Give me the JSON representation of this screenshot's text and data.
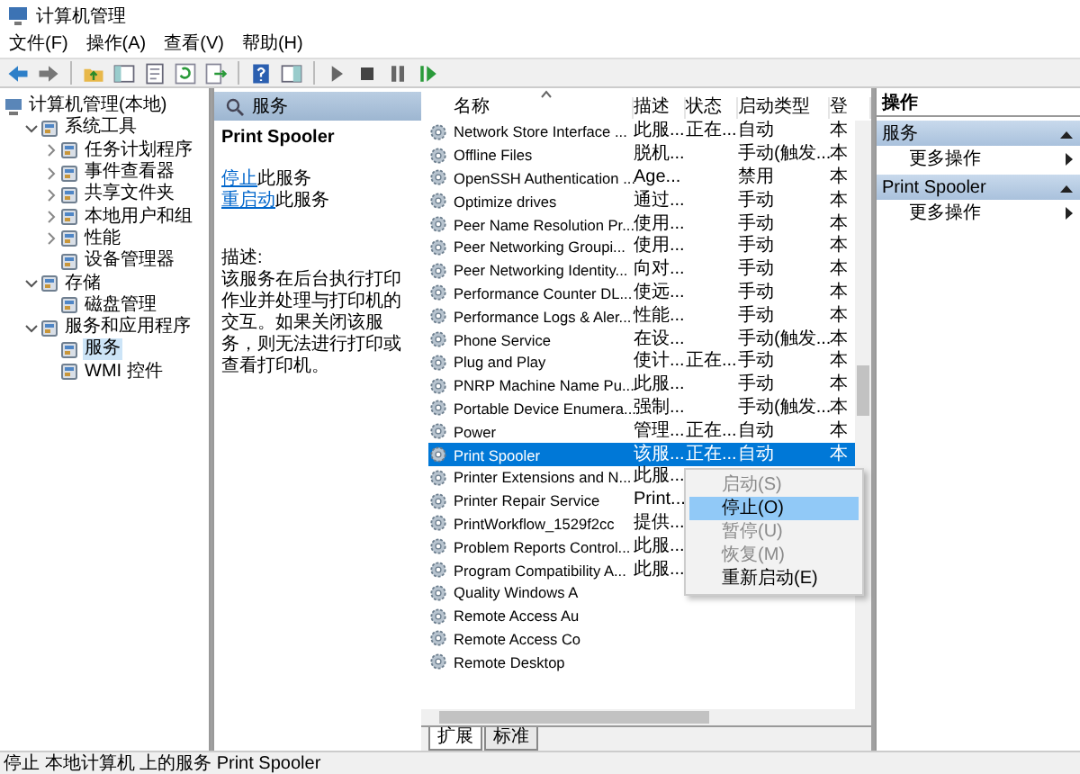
{
  "window": {
    "title": "计算机管理"
  },
  "menu": [
    "文件(F)",
    "操作(A)",
    "查看(V)",
    "帮助(H)"
  ],
  "tree": [
    {
      "label": "计算机管理(本地)",
      "selected": false,
      "children": [
        {
          "label": "系统工具",
          "expanded": true,
          "selected": false,
          "children": [
            {
              "label": "任务计划程序",
              "expanded": false,
              "selected": false
            },
            {
              "label": "事件查看器",
              "expanded": false,
              "selected": false
            },
            {
              "label": "共享文件夹",
              "expanded": false,
              "selected": false
            },
            {
              "label": "本地用户和组",
              "expanded": false,
              "selected": false
            },
            {
              "label": "性能",
              "expanded": false,
              "selected": false
            },
            {
              "label": "设备管理器",
              "selected": false
            }
          ]
        },
        {
          "label": "存储",
          "expanded": true,
          "selected": false,
          "children": [
            {
              "label": "磁盘管理",
              "selected": false
            }
          ]
        },
        {
          "label": "服务和应用程序",
          "expanded": true,
          "selected": false,
          "children": [
            {
              "label": "服务",
              "selected": true
            },
            {
              "label": "WMI 控件",
              "selected": false
            }
          ]
        }
      ]
    }
  ],
  "detail": {
    "header": "服务",
    "service_name": "Print Spooler",
    "links": [
      {
        "link": "停止",
        "text": "此服务"
      },
      {
        "link": "重启动",
        "text": "此服务"
      }
    ],
    "description_label": "描述:",
    "description": "该服务在后台执行打印作业并处理与打印机的交互。如果关闭该服务，则无法进行打印或查看打印机。"
  },
  "table": {
    "columns": [
      "名称",
      "描述",
      "状态",
      "启动类型",
      "登"
    ],
    "rows": [
      {
        "cells": [
          "Network Store Interface ...",
          "此服...",
          "正在...",
          "自动",
          "本"
        ],
        "selected": false
      },
      {
        "cells": [
          "Offline Files",
          "脱机...",
          "",
          "手动(触发...",
          "本"
        ],
        "selected": false
      },
      {
        "cells": [
          "OpenSSH Authentication ...",
          "Age...",
          "",
          "禁用",
          "本"
        ],
        "selected": false
      },
      {
        "cells": [
          "Optimize drives",
          "通过...",
          "",
          "手动",
          "本"
        ],
        "selected": false
      },
      {
        "cells": [
          "Peer Name Resolution Pr...",
          "使用...",
          "",
          "手动",
          "本"
        ],
        "selected": false
      },
      {
        "cells": [
          "Peer Networking Groupi...",
          "使用...",
          "",
          "手动",
          "本"
        ],
        "selected": false
      },
      {
        "cells": [
          "Peer Networking Identity...",
          "向对...",
          "",
          "手动",
          "本"
        ],
        "selected": false
      },
      {
        "cells": [
          "Performance Counter DL...",
          "使远...",
          "",
          "手动",
          "本"
        ],
        "selected": false
      },
      {
        "cells": [
          "Performance Logs & Aler...",
          "性能...",
          "",
          "手动",
          "本"
        ],
        "selected": false
      },
      {
        "cells": [
          "Phone Service",
          "在设...",
          "",
          "手动(触发...",
          "本"
        ],
        "selected": false
      },
      {
        "cells": [
          "Plug and Play",
          "使计...",
          "正在...",
          "手动",
          "本"
        ],
        "selected": false
      },
      {
        "cells": [
          "PNRP Machine Name Pu...",
          "此服...",
          "",
          "手动",
          "本"
        ],
        "selected": false
      },
      {
        "cells": [
          "Portable Device Enumera...",
          "强制...",
          "",
          "手动(触发...",
          "本"
        ],
        "selected": false
      },
      {
        "cells": [
          "Power",
          "管理...",
          "正在...",
          "自动",
          "本"
        ],
        "selected": false
      },
      {
        "cells": [
          "Print Spooler",
          "该服...",
          "正在...",
          "自动",
          "本"
        ],
        "selected": true
      },
      {
        "cells": [
          "Printer Extensions and N...",
          "此服..."
        ],
        "selected": false
      },
      {
        "cells": [
          "Printer Repair Service",
          "Print..."
        ],
        "selected": false
      },
      {
        "cells": [
          "PrintWorkflow_1529f2cc",
          "提供..."
        ],
        "selected": false
      },
      {
        "cells": [
          "Problem Reports Control...",
          "此服..."
        ],
        "selected": false
      },
      {
        "cells": [
          "Program Compatibility A...",
          "此服..."
        ],
        "selected": false
      },
      {
        "cells": [
          "Quality Windows A"
        ],
        "selected": false
      },
      {
        "cells": [
          "Remote Access Au"
        ],
        "selected": false
      },
      {
        "cells": [
          "Remote Access Co"
        ],
        "selected": false
      },
      {
        "cells": [
          "Remote Desktop"
        ],
        "selected": false
      }
    ]
  },
  "context_menu": [
    {
      "label": "启动(S)",
      "disabled": true,
      "highlighted": false
    },
    {
      "label": "停止(O)",
      "disabled": false,
      "highlighted": true
    },
    {
      "label": "暂停(U)",
      "disabled": true,
      "highlighted": false
    },
    {
      "label": "恢复(M)",
      "disabled": true,
      "highlighted": false
    },
    {
      "label": "重新启动(E)",
      "disabled": false,
      "highlighted": false
    }
  ],
  "view_tabs": [
    {
      "label": "扩展",
      "selected": true
    },
    {
      "label": "标准",
      "selected": false
    }
  ],
  "actions": {
    "header": "操作",
    "sections": [
      {
        "title": "服务",
        "items": [
          "更多操作"
        ]
      },
      {
        "title": "Print Spooler",
        "items": [
          "更多操作"
        ]
      }
    ]
  },
  "status_bar": "停止 本地计算机 上的服务 Print Spooler"
}
